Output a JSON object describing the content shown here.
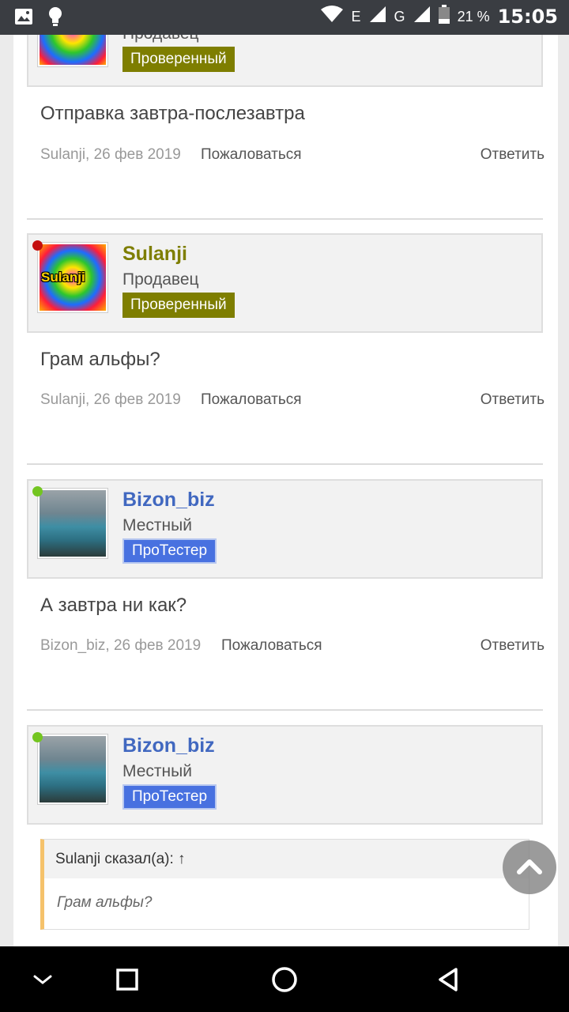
{
  "status_bar": {
    "net_e": "E",
    "net_g": "G",
    "battery": "21 %",
    "time": "15:05"
  },
  "posts": [
    {
      "partial": true,
      "role": "Продавец",
      "badge": "Проверенный",
      "message": "Отправка завтра-послезавтра",
      "meta": "Sulanji, 26 фев 2019",
      "complain": "Пожаловаться",
      "reply": "Ответить"
    },
    {
      "username": "Sulanji",
      "avatar_text": "Sulanji",
      "role": "Продавец",
      "badge": "Проверенный",
      "message": "Грам альфы?",
      "meta": "Sulanji, 26 фев 2019",
      "complain": "Пожаловаться",
      "reply": "Ответить",
      "status_color": "#c40f0f"
    },
    {
      "username": "Bizon_biz",
      "role": "Местный",
      "badge": "ПроТестер",
      "message": "А завтра ни как?",
      "meta": "Bizon_biz, 26 фев 2019",
      "complain": "Пожаловаться",
      "reply": "Ответить",
      "status_color": "#73c520"
    },
    {
      "username": "Bizon_biz",
      "role": "Местный",
      "badge": "ПроТестер",
      "status_color": "#73c520",
      "quote": {
        "header": "Sulanji сказал(а): ↑",
        "text": "Грам альфы?"
      }
    }
  ],
  "icons": {
    "status_left": [
      "image-icon",
      "lightbulb-icon"
    ],
    "status_right": [
      "wifi-icon",
      "signal-icon",
      "battery-icon"
    ],
    "fab": "chevron-up-icon",
    "nav": [
      "chevron-down-icon",
      "square-icon",
      "circle-icon",
      "triangle-back-icon"
    ]
  },
  "colors": {
    "seller_name": "#7e7e00",
    "local_name": "#4168c0",
    "verified_badge": "#7e7e00",
    "tester_badge": "#4871e0",
    "quote_border": "#f5c26b"
  }
}
